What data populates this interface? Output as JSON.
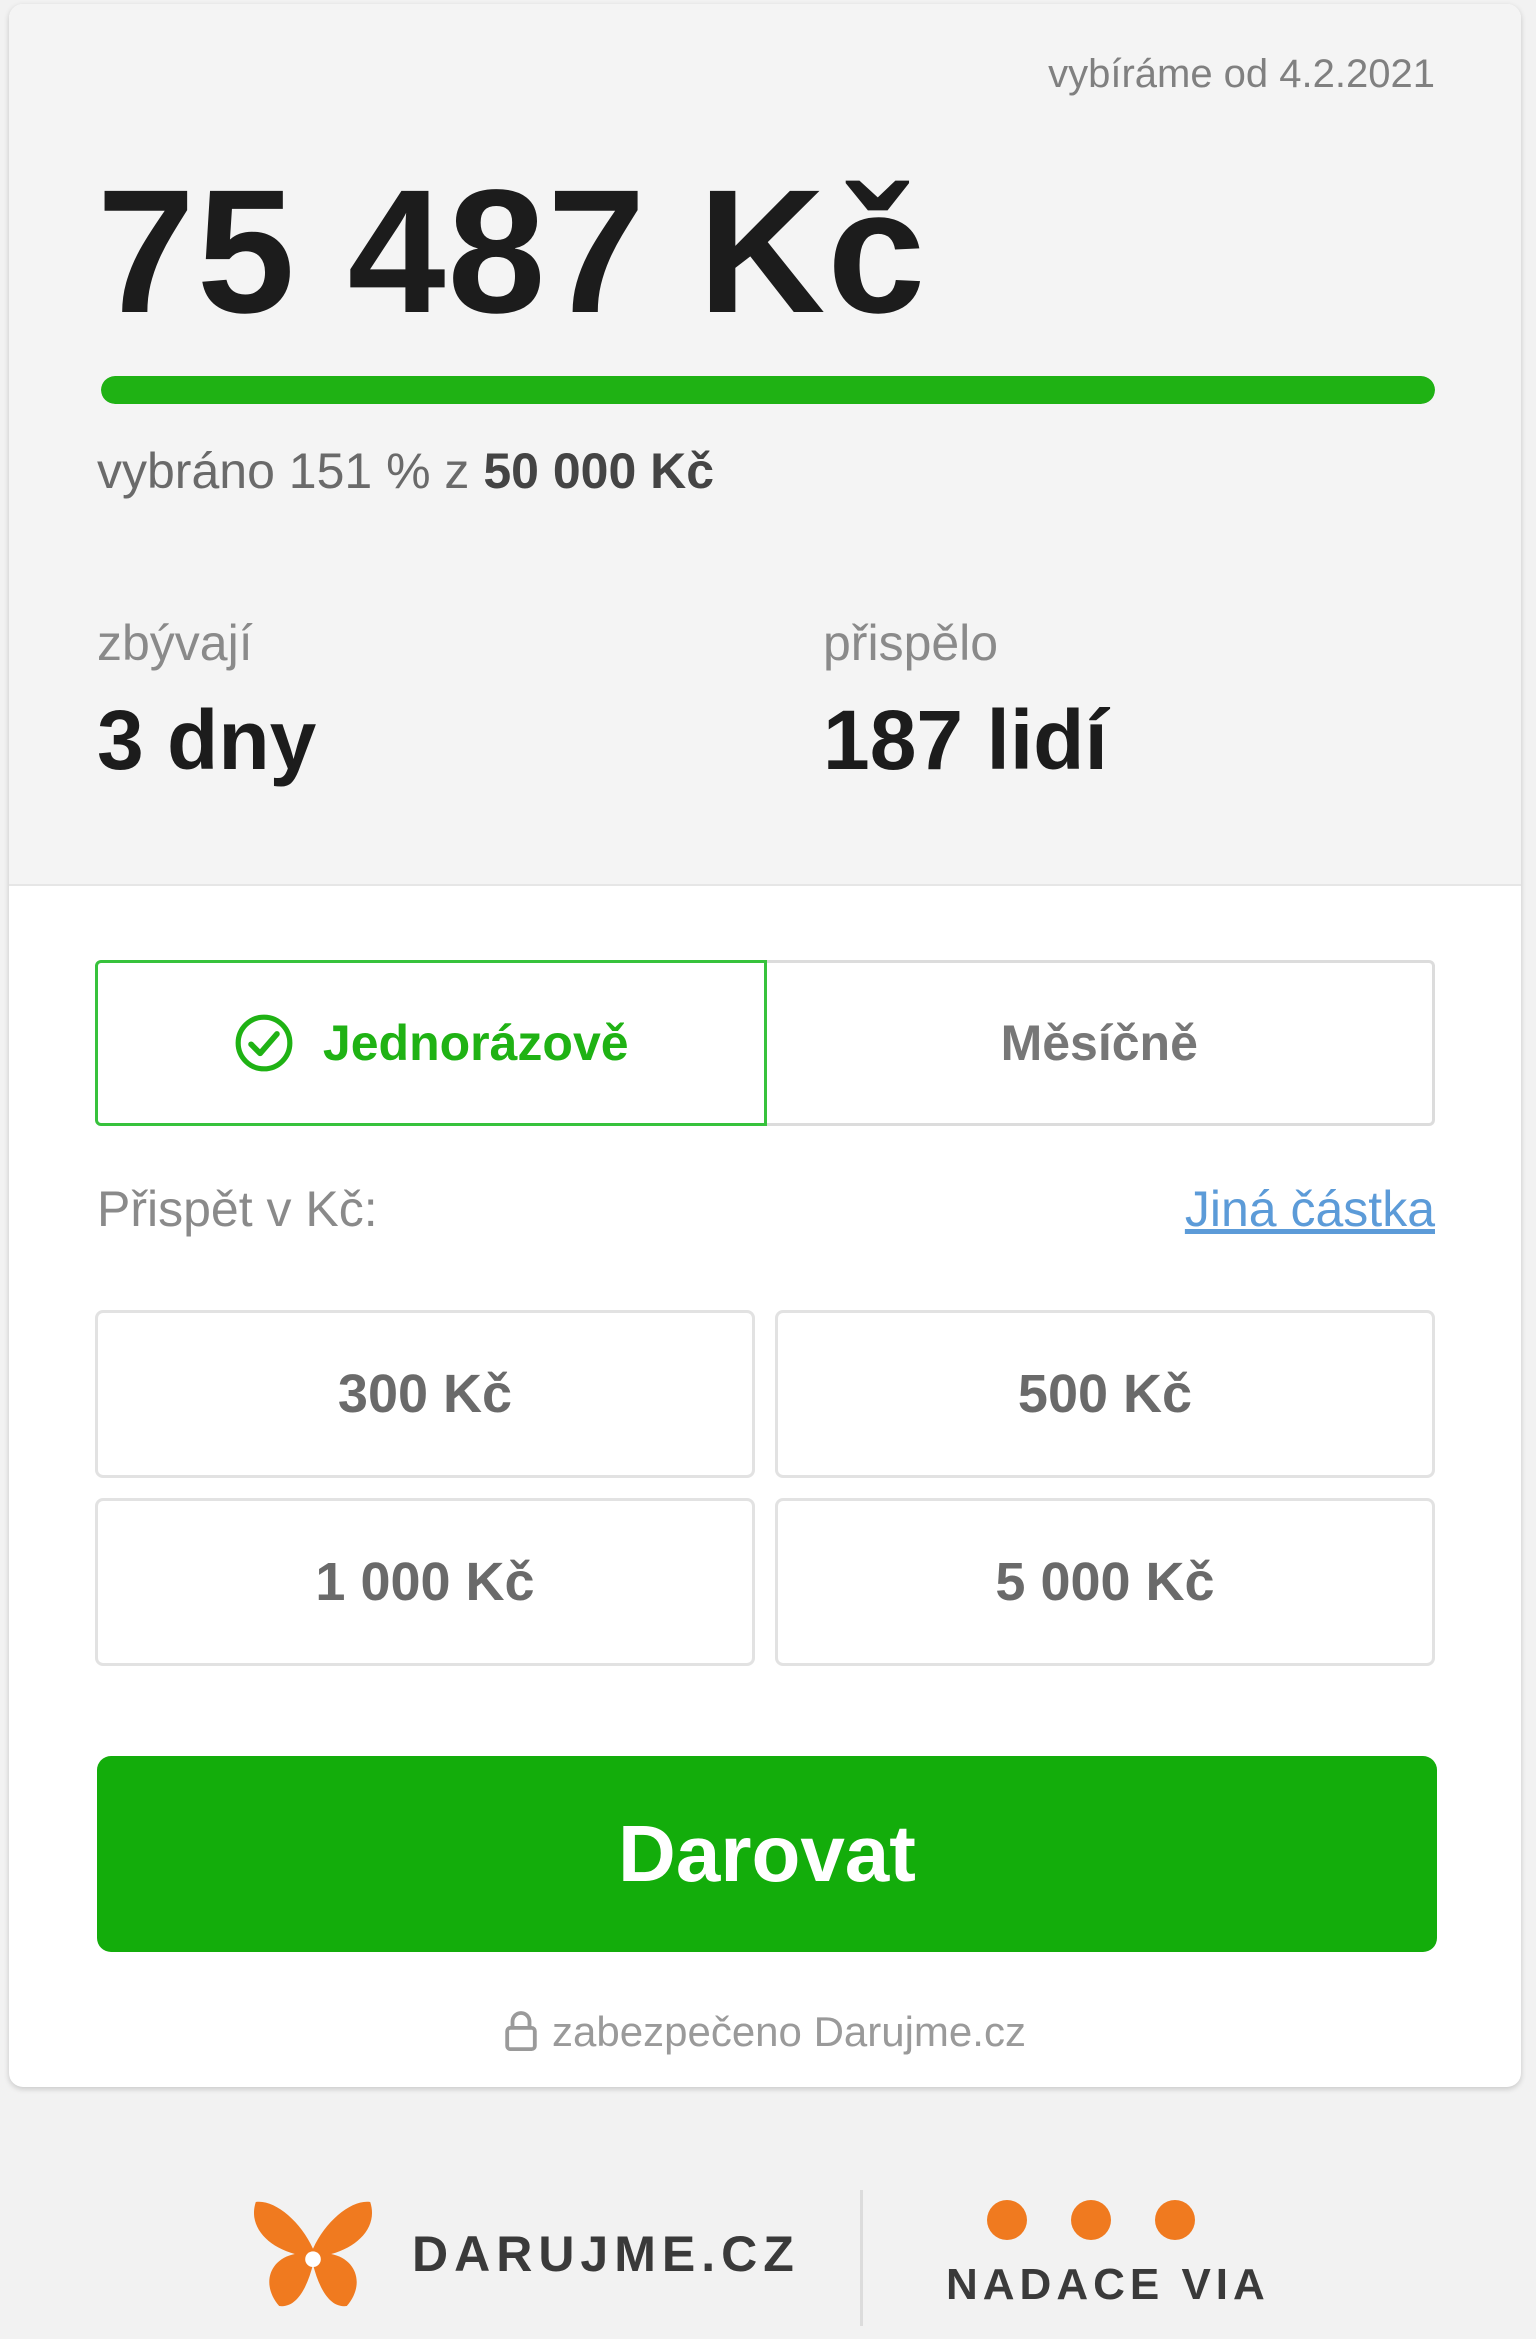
{
  "stats": {
    "since_text": "vybíráme od 4.2.2021",
    "amount": "75 487 Kč",
    "progress_percent": 151,
    "progress_prefix": "vybráno 151 % z",
    "goal": "50 000 Kč",
    "remaining_label": "zbývají",
    "remaining_value": "3 dny",
    "contributors_label": "přispělo",
    "contributors_value": "187 lidí"
  },
  "frequency": {
    "once_label": "Jednorázově",
    "monthly_label": "Měsíčně",
    "selected": "once"
  },
  "donation": {
    "contribute_label": "Přispět v Kč:",
    "other_amount_link": "Jiná částka",
    "amounts": [
      "300 Kč",
      "500 Kč",
      "1 000 Kč",
      "5 000 Kč"
    ],
    "donate_label": "Darovat",
    "secure_text": "zabezpečeno Darujme.cz"
  },
  "footer": {
    "darujme_logo_text": "DARUJME.CZ",
    "via_logo_text": "NADACE VIA"
  },
  "colors": {
    "accent_green": "#13ad0b",
    "link_blue": "#5c9bd8",
    "logo_orange": "#f07a1f"
  },
  "icons": {
    "check": "check-circle-icon",
    "lock": "lock-icon",
    "butterfly": "butterfly-icon"
  }
}
